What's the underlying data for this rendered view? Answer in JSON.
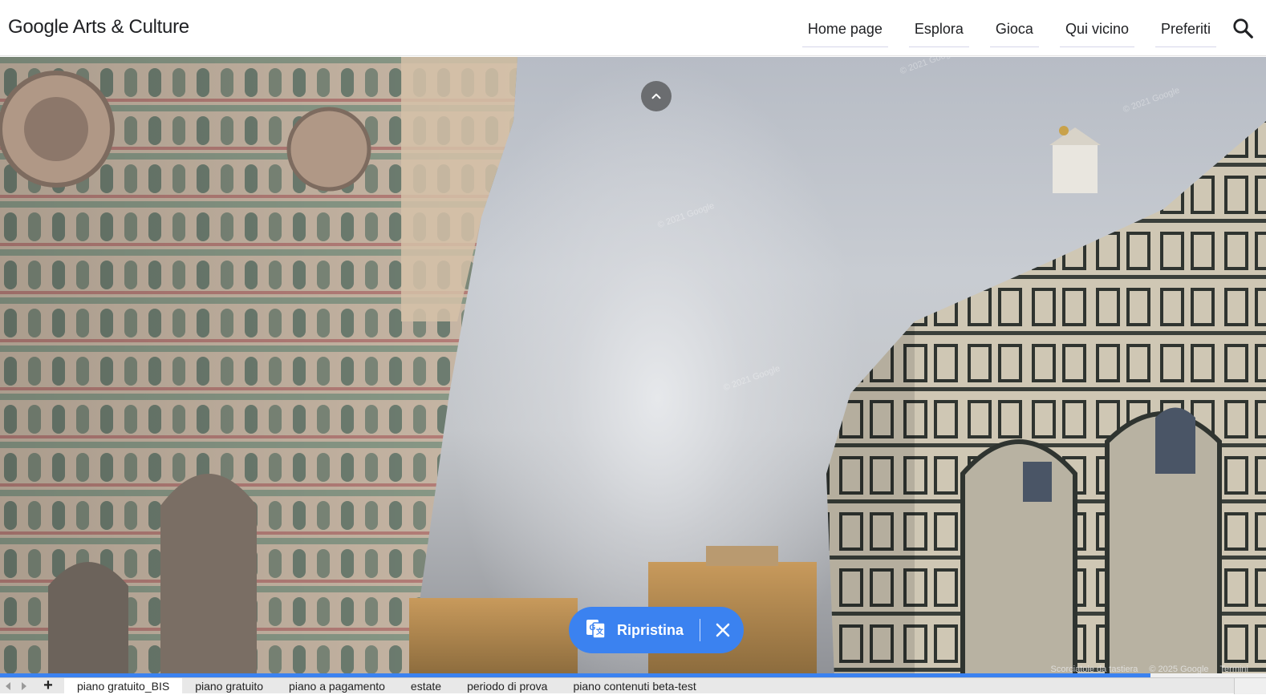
{
  "header": {
    "logo_google": "Google",
    "logo_rest": " Arts & Culture",
    "nav": [
      {
        "label": "Home page"
      },
      {
        "label": "Esplora"
      },
      {
        "label": "Gioca"
      },
      {
        "label": "Qui vicino"
      },
      {
        "label": "Preferiti"
      }
    ],
    "search_icon": "search-icon"
  },
  "viewer": {
    "up_icon": "chevron-up-icon",
    "restore": {
      "icon": "translate-icon",
      "label": "Ripristina",
      "close_icon": "close-icon"
    },
    "progress_fraction": 0.909,
    "attribution": {
      "shortcuts": "Scorciatoie da tastiera",
      "copyright": "© 2025 Google",
      "terms": "Termini"
    }
  },
  "sheet_tabs": {
    "tabs": [
      {
        "label": "piano gratuito_BIS"
      },
      {
        "label": "piano gratuito"
      },
      {
        "label": "piano a pagamento"
      },
      {
        "label": "estate"
      },
      {
        "label": "periodo di prova"
      },
      {
        "label": "piano contenuti beta-test"
      }
    ],
    "add_label": "+"
  },
  "colors": {
    "accent_blue": "#3b82f0",
    "text_dark": "#202124"
  }
}
